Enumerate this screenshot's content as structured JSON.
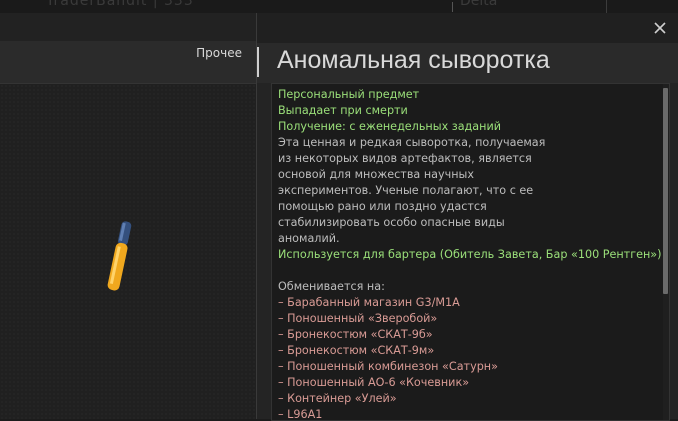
{
  "topbar": {
    "ghost_left": "TraderBandit | 333",
    "ghost_right": "Delta"
  },
  "tabs": {
    "other_label": "Прочее"
  },
  "modal": {
    "title": "Аномальная сыворотка",
    "close_icon": "close-icon"
  },
  "item": {
    "properties": [
      "Персональный предмет",
      "Выпадает при смерти",
      "Получение: с еженедельных заданий"
    ],
    "description_lines": [
      "Эта ценная и редкая сыворотка, получаемая",
      "из некоторых видов артефактов, является",
      "основой для множества научных",
      "экспериментов. Ученые полагают, что с ее",
      "помощью рано или поздно удастся",
      "стабилизировать особо опасные виды",
      "аномалий."
    ],
    "barter_usage": "Используется для бартера (Обитель Завета, Бар «100 Рентген»)",
    "exchange_header": "Обменивается на:",
    "exchange_items": [
      "– Барабанный магазин G3/M1A",
      "– Поношенный «Зверобой»",
      "– Бронекостюм «СКАТ-9б»",
      "– Бронекостюм «СКАТ-9м»",
      "– Поношенный комбинезон «Сатурн»",
      "– Поношенный АО-6 «Кочевник»",
      "– Контейнер «Улей»",
      "– L96A1"
    ]
  },
  "colors": {
    "green_text": "#9be07a",
    "red_text": "#d99b95",
    "vial_liquid": "#f0a81e",
    "vial_cap": "#3c5a8c"
  },
  "icons": {
    "item_image": "serum-vial-icon"
  }
}
